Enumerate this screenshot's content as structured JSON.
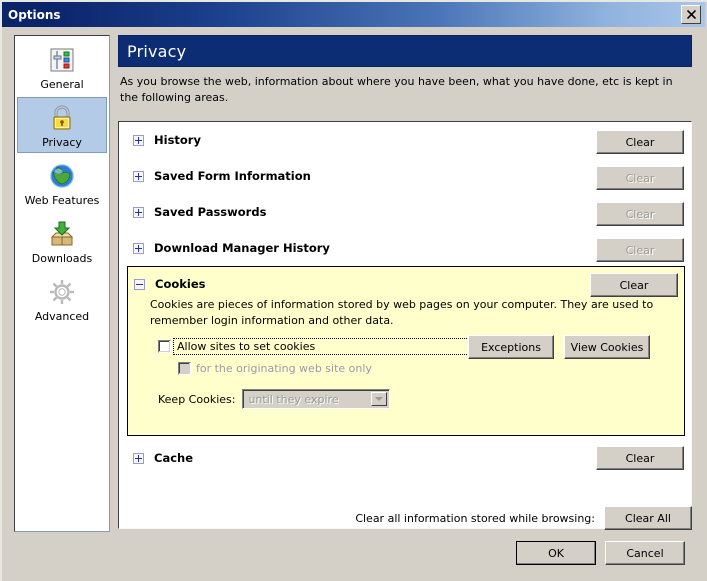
{
  "window": {
    "title": "Options",
    "close_label": "✕",
    "close_icon": "close-icon"
  },
  "sidebar": {
    "items": [
      {
        "label": "General",
        "icon": "sliders-icon",
        "selected": false
      },
      {
        "label": "Privacy",
        "icon": "lock-icon",
        "selected": true
      },
      {
        "label": "Web Features",
        "icon": "globe-icon",
        "selected": false
      },
      {
        "label": "Downloads",
        "icon": "download-box-icon",
        "selected": false
      },
      {
        "label": "Advanced",
        "icon": "gear-icon",
        "selected": false
      }
    ]
  },
  "pane": {
    "title": "Privacy",
    "description": "As you browse the web, information about where you have been, what you have done, etc is kept in the following areas."
  },
  "sections": [
    {
      "label": "History",
      "expanded": false,
      "clear_label": "Clear",
      "clear_enabled": true
    },
    {
      "label": "Saved Form Information",
      "expanded": false,
      "clear_label": "Clear",
      "clear_enabled": false
    },
    {
      "label": "Saved Passwords",
      "expanded": false,
      "clear_label": "Clear",
      "clear_enabled": false
    },
    {
      "label": "Download Manager History",
      "expanded": false,
      "clear_label": "Clear",
      "clear_enabled": false
    },
    {
      "label": "Cookies",
      "expanded": true,
      "clear_label": "Clear",
      "clear_enabled": true
    },
    {
      "label": "Cache",
      "expanded": false,
      "clear_label": "Clear",
      "clear_enabled": true
    }
  ],
  "cookies": {
    "header_label": "Cookies",
    "clear_label": "Clear",
    "description": "Cookies are pieces of information stored by web pages on your computer. They are used to remember login information and other data.",
    "allow_checkbox_label": "Allow sites to set cookies",
    "allow_checkbox_checked": false,
    "allow_checkbox_focused": true,
    "originating_checkbox_label": "for the originating web site only",
    "originating_checkbox_checked": false,
    "originating_checkbox_enabled": false,
    "exceptions_label": "Exceptions",
    "view_cookies_label": "View Cookies",
    "keep_cookies_label": "Keep Cookies:",
    "keep_cookies_value": "until they expire",
    "keep_cookies_enabled": false,
    "keep_cookies_options": [
      "until they expire"
    ],
    "background_color": "#ffffcc"
  },
  "footer": {
    "clear_all_text": "Clear all information stored while browsing:",
    "clear_all_label": "Clear All",
    "ok_label": "OK",
    "cancel_label": "Cancel"
  },
  "colors": {
    "titlebar_start": "#0a246a",
    "titlebar_end": "#a8c6e8",
    "pane_header_bg": "#0c2c73",
    "dialog_face": "#d4d0c8",
    "selected_item": "#b4cbe8",
    "cookie_panel": "#ffffcc",
    "disabled_text": "#9d9a93"
  }
}
